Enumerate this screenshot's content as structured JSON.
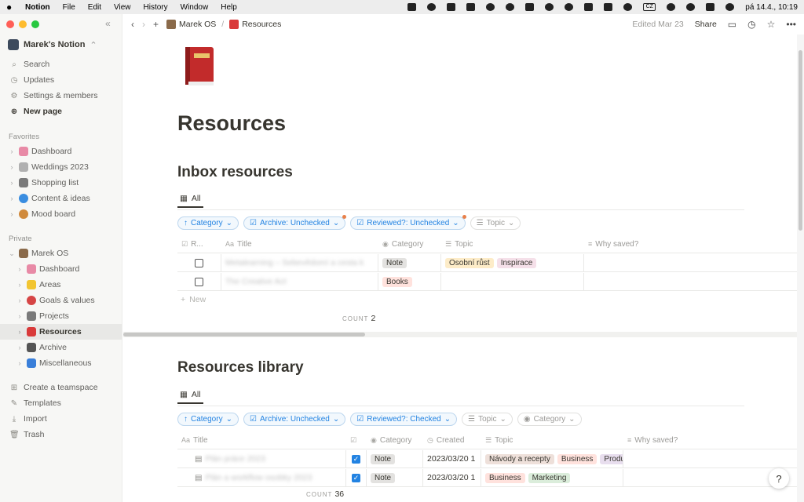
{
  "menubar": {
    "app": "Notion",
    "items": [
      "File",
      "Edit",
      "View",
      "History",
      "Window",
      "Help"
    ],
    "input_source": "CZ",
    "clock": "pá 14.4., 10:19"
  },
  "sidebar": {
    "workspace": "Marek's Notion",
    "top_items": [
      {
        "label": "Search",
        "icon": "search-icon"
      },
      {
        "label": "Updates",
        "icon": "clock-icon"
      },
      {
        "label": "Settings & members",
        "icon": "gear-icon"
      },
      {
        "label": "New page",
        "icon": "plus-circle-icon"
      }
    ],
    "favorites_label": "Favorites",
    "favorites": [
      {
        "label": "Dashboard",
        "color": "#e88aa6"
      },
      {
        "label": "Weddings 2023",
        "color": "#b0b0b0"
      },
      {
        "label": "Shopping list",
        "color": "#7a7a7a"
      },
      {
        "label": "Content & ideas",
        "color": "#3a8de0"
      },
      {
        "label": "Mood board",
        "color": "#d08a3c"
      }
    ],
    "private_label": "Private",
    "root_page": "Marek OS",
    "children": [
      {
        "label": "Dashboard",
        "color": "#e88aa6"
      },
      {
        "label": "Areas",
        "color": "#f2c531"
      },
      {
        "label": "Goals & values",
        "color": "#d64545"
      },
      {
        "label": "Projects",
        "color": "#7a7a7a"
      },
      {
        "label": "Resources",
        "color": "#d93a3a"
      },
      {
        "label": "Archive",
        "color": "#555555"
      },
      {
        "label": "Miscellaneous",
        "color": "#3a7fd9"
      }
    ],
    "bottom_items": [
      {
        "label": "Create a teamspace",
        "icon": "teamspace-icon"
      },
      {
        "label": "Templates",
        "icon": "templates-icon"
      },
      {
        "label": "Import",
        "icon": "import-icon"
      },
      {
        "label": "Trash",
        "icon": "trash-icon"
      }
    ]
  },
  "topbar": {
    "crumbs": [
      "Marek OS",
      "Resources"
    ],
    "edited": "Edited Mar 23",
    "share": "Share"
  },
  "page": {
    "title": "Resources"
  },
  "inbox": {
    "heading": "Inbox resources",
    "view": "All",
    "filters": [
      {
        "label": "Category",
        "prefix": "↑"
      },
      {
        "label": "Archive: Unchecked",
        "dot": true
      },
      {
        "label": "Reviewed?: Unchecked",
        "dot": true
      },
      {
        "label": "Topic",
        "grey": true
      }
    ],
    "columns": [
      "R...",
      "Title",
      "Category",
      "Topic",
      "Why saved?"
    ],
    "rows": [
      {
        "title": "Metalearning – Sebevědomí a cesta k",
        "category": "Note",
        "topics": [
          "Osobní růst",
          "Inspirace"
        ]
      },
      {
        "title": "The Creative Act",
        "category": "Books",
        "topics": []
      }
    ],
    "new_label": "New",
    "count_label": "COUNT",
    "count": "2"
  },
  "library": {
    "heading": "Resources library",
    "view": "All",
    "filters": [
      {
        "label": "Category",
        "prefix": "↑"
      },
      {
        "label": "Archive: Unchecked"
      },
      {
        "label": "Reviewed?: Checked"
      },
      {
        "label": "Topic",
        "grey": true
      },
      {
        "label": "Category",
        "grey": true
      }
    ],
    "columns": [
      "Title",
      "",
      "Category",
      "Created",
      "Topic",
      "Why saved?"
    ],
    "rows": [
      {
        "title": "Plán práce 2023",
        "category": "Note",
        "created": "2023/03/20 1",
        "topics": [
          "Návody a recepty",
          "Business",
          "Produ"
        ]
      },
      {
        "title": "Plán a workflow osobky 2023",
        "category": "Note",
        "created": "2023/03/20 1",
        "topics": [
          "Business",
          "Marketing"
        ]
      }
    ],
    "count_label": "COUNT",
    "count": "36"
  },
  "help": "?"
}
